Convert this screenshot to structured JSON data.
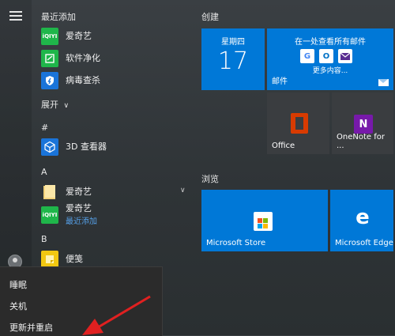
{
  "sidebar": {
    "recently_added_title": "最近添加",
    "recent_apps": [
      {
        "label": "爱奇艺",
        "icon": "iqiyi-icon",
        "badge": "iQIYI"
      },
      {
        "label": "软件净化",
        "icon": "software-clean-icon"
      },
      {
        "label": "病毒查杀",
        "icon": "virus-scan-icon"
      }
    ],
    "expand_label": "展开",
    "sections": [
      {
        "letter": "#",
        "apps": [
          {
            "label": "3D 查看器",
            "icon": "3d-viewer-icon"
          }
        ]
      },
      {
        "letter": "A",
        "apps": [
          {
            "label": "爱奇艺",
            "icon": "folder-icon"
          },
          {
            "label": "爱奇艺",
            "sublabel": "最近添加",
            "icon": "iqiyi-icon",
            "badge": "iQIYI"
          }
        ]
      },
      {
        "letter": "B",
        "apps": [
          {
            "label": "便笺",
            "icon": "sticky-notes-icon"
          }
        ]
      }
    ]
  },
  "power_menu": {
    "items": [
      "睡眠",
      "关机",
      "更新并重启"
    ]
  },
  "tiles": {
    "create_title": "创建",
    "calendar": {
      "weekday": "星期四",
      "day": "17"
    },
    "mail": {
      "title": "在一处查看所有邮件",
      "more": "更多内容...",
      "label": "邮件"
    },
    "office": {
      "label": "Office"
    },
    "onenote": {
      "label": "OneNote for ..."
    },
    "browse_title": "浏览",
    "store": {
      "label": "Microsoft Store"
    },
    "edge": {
      "label": "Microsoft Edge"
    }
  },
  "colors": {
    "tile_blue": "#0078d7",
    "iqiyi_green": "#1fb64a",
    "office_orange": "#d83b01",
    "onenote_purple": "#7719aa",
    "power_menu_bg": "#2b2b2b",
    "arrow_red": "#e02020"
  }
}
